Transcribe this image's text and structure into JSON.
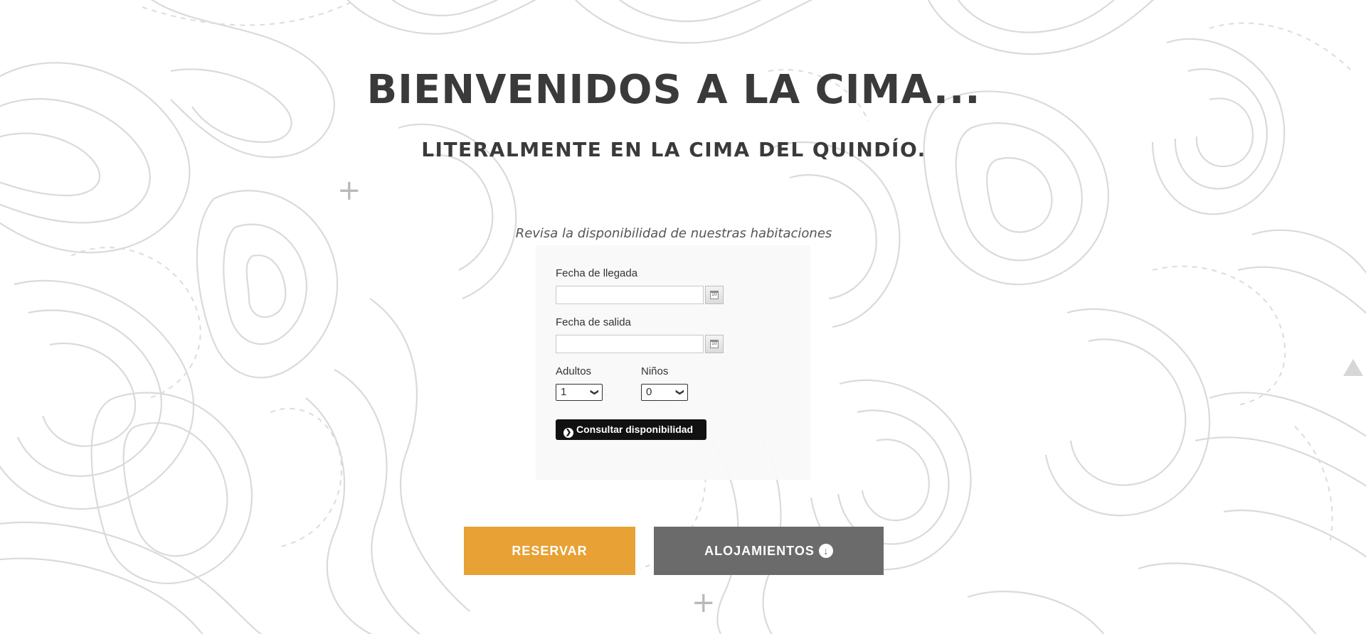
{
  "hero": {
    "title": "BIENVENIDOS A LA CIMA...",
    "subtitle": "LITERALMENTE EN LA CIMA DEL QUINDÍO."
  },
  "booking": {
    "caption": "Revisa la disponibilidad de nuestras habitaciones",
    "arrival_label": "Fecha de llegada",
    "arrival_value": "",
    "departure_label": "Fecha de salida",
    "departure_value": "",
    "adults_label": "Adultos",
    "adults_value": "1",
    "children_label": "Niños",
    "children_value": "0",
    "calendar_icon_text": "10",
    "check_button_label": "Consultar disponibilidad"
  },
  "cta": {
    "reserve_label": "RESERVAR",
    "lodging_label": "ALOJAMIENTOS"
  },
  "icons": {
    "calendar": "calendar-icon",
    "select_chevron": "chevron-down-icon",
    "check_arrow": "circle-arrow-right-icon",
    "lodging_arrow": "circle-arrow-down-icon",
    "plus": "plus-icon",
    "scroll_top": "triangle-up-icon"
  },
  "colors": {
    "reserve": "#e8a134",
    "lodging": "#6b6b6b",
    "check_button": "#111111",
    "title": "#3a3a3a",
    "contour_lines": "#d9d9d9"
  }
}
